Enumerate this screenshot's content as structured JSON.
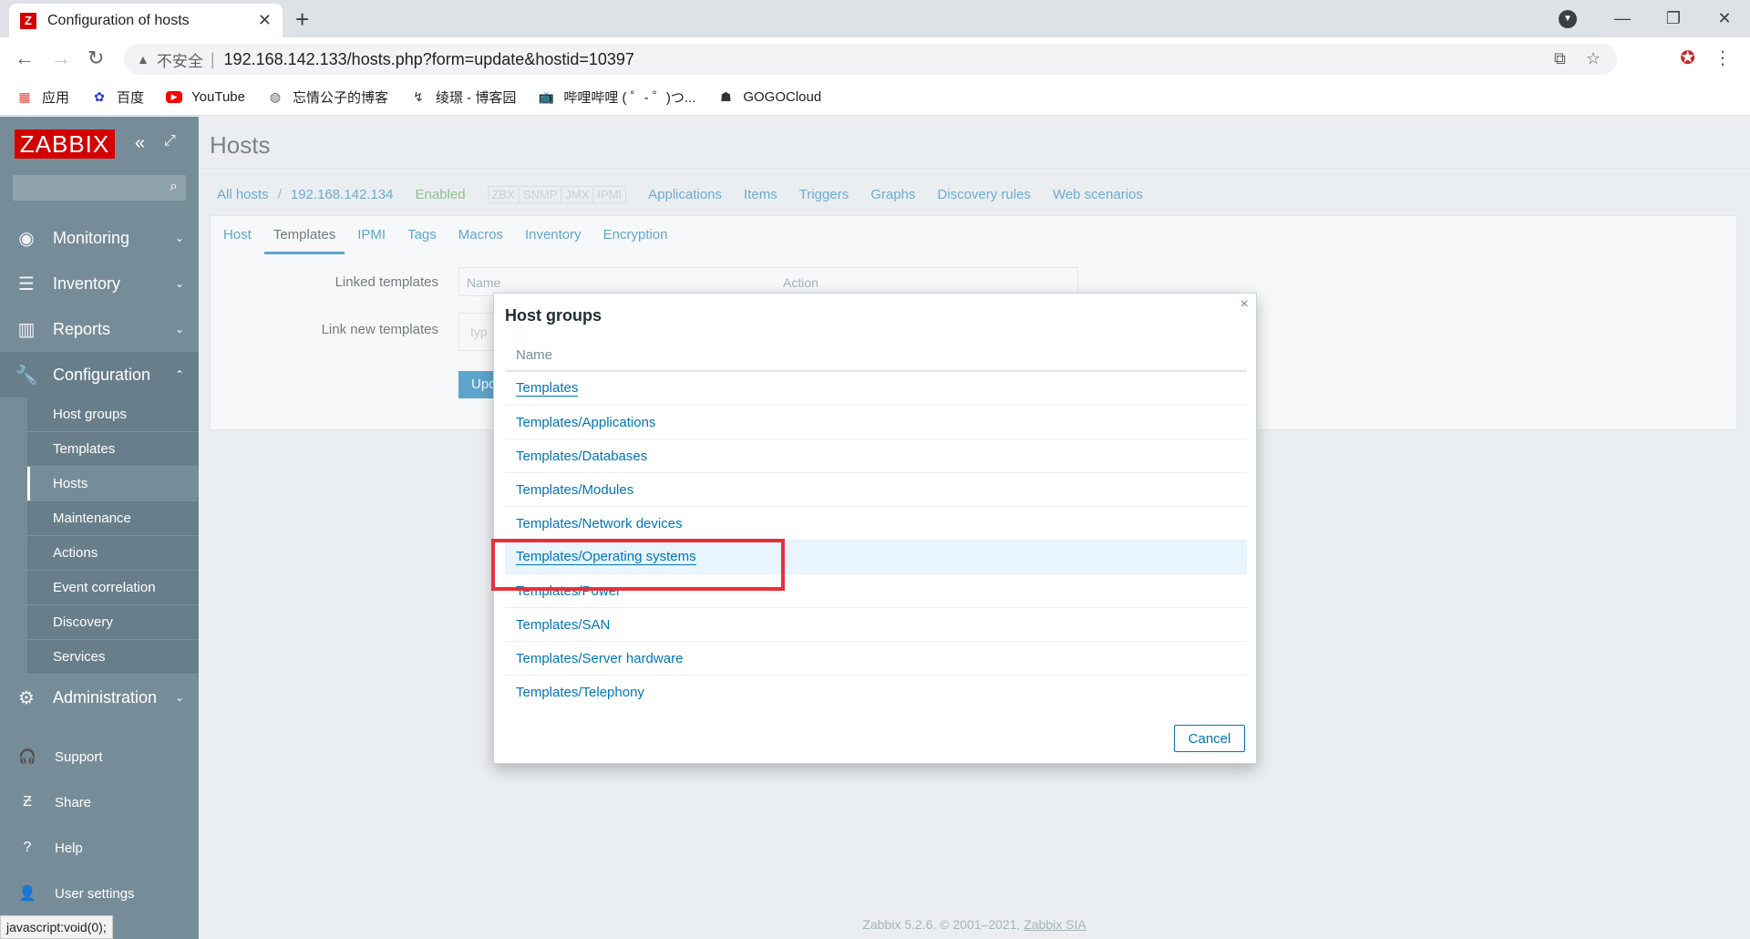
{
  "browser": {
    "tab_title": "Configuration of hosts",
    "tab_favicon_letter": "Z",
    "insecure_label": "不安全",
    "url": "192.168.142.133/hosts.php?form=update&hostid=10397",
    "bookmarks": [
      {
        "label": "应用",
        "icon": "apps-grid-icon"
      },
      {
        "label": "百度",
        "icon": "baidu-paw-icon"
      },
      {
        "label": "YouTube",
        "icon": "youtube-icon"
      },
      {
        "label": "忘情公子的博客",
        "icon": "globe-icon"
      },
      {
        "label": "绫璟 - 博客园",
        "icon": "blog-icon"
      },
      {
        "label": "哔哩哔哩 ( ゜- ゜)つ...",
        "icon": "bilibili-icon"
      },
      {
        "label": "GOGOCloud",
        "icon": "gogocloud-icon"
      }
    ]
  },
  "sidebar": {
    "logo": "ZABBIX",
    "menu": {
      "monitoring": "Monitoring",
      "inventory": "Inventory",
      "reports": "Reports",
      "configuration": "Configuration",
      "administration": "Administration"
    },
    "config_items": [
      "Host groups",
      "Templates",
      "Hosts",
      "Maintenance",
      "Actions",
      "Event correlation",
      "Discovery",
      "Services"
    ],
    "active_item": "Hosts",
    "bottom": {
      "support": "Support",
      "share": "Share",
      "help": "Help",
      "user_settings": "User settings"
    },
    "status_tip": "javascript:void(0);"
  },
  "main": {
    "page_title": "Hosts",
    "host_nav": {
      "all_hosts": "All hosts",
      "separator": "/",
      "host_name": "192.168.142.134",
      "status": "Enabled",
      "badges": [
        "ZBX",
        "SNMP",
        "JMX",
        "IPMI"
      ],
      "links": [
        "Applications",
        "Items",
        "Triggers",
        "Graphs",
        "Discovery rules",
        "Web scenarios"
      ]
    },
    "tabs": [
      "Host",
      "Templates",
      "IPMI",
      "Tags",
      "Macros",
      "Inventory",
      "Encryption"
    ],
    "active_tab": "Templates",
    "linked_templates_label": "Linked templates",
    "linked_table_cols": {
      "name": "Name",
      "action": "Action"
    },
    "link_new_label": "Link new templates",
    "link_new_placeholder": "typ",
    "update_button": "Upd",
    "footer": {
      "text": "Zabbix 5.2.6. © 2001–2021,",
      "link": "Zabbix SIA"
    }
  },
  "dialog": {
    "title": "Host groups",
    "column": "Name",
    "rows": [
      "Templates",
      "Templates/Applications",
      "Templates/Databases",
      "Templates/Modules",
      "Templates/Network devices",
      "Templates/Operating systems",
      "Templates/Power",
      "Templates/SAN",
      "Templates/Server hardware",
      "Templates/Telephony"
    ],
    "highlighted_row": "Templates/Operating systems",
    "cancel": "Cancel",
    "close_glyph": "×"
  },
  "colors": {
    "zabbix_red": "#d40000",
    "sidebar_bg": "#768d99",
    "link_blue": "#0275b8",
    "highlight_red": "#e8303a"
  }
}
